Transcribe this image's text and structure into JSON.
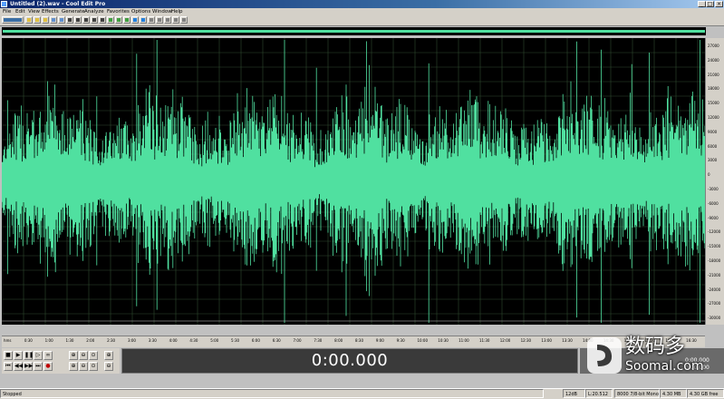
{
  "window": {
    "title": "Untitled (2).wav - Cool Edit Pro",
    "controls": [
      "_",
      "□",
      "×"
    ]
  },
  "menu": [
    "File",
    "Edit",
    "View",
    "Effects",
    "Generate",
    "Analyze",
    "Favorites",
    "Options",
    "Window",
    "Help"
  ],
  "colors": {
    "waveform": "#50e0a0",
    "background": "#000000",
    "grid": "#2e4a2e"
  },
  "icons": {
    "app": "cool-edit-icon",
    "transport": [
      "stop-icon",
      "play-icon",
      "pause-icon",
      "play-loop-icon",
      "loop-icon",
      "go-start-icon",
      "rewind-icon",
      "fast-forward-icon",
      "go-end-icon",
      "record-icon"
    ],
    "zoom": [
      "zoom-in-horizontal-icon",
      "zoom-out-horizontal-icon",
      "zoom-full-icon",
      "zoom-in-vertical-icon",
      "zoom-out-vertical-icon",
      "zoom-selection-icon"
    ]
  },
  "amplitude_ruler": {
    "labels": [
      "27000",
      "24000",
      "21000",
      "18000",
      "15000",
      "12000",
      "9000",
      "6000",
      "3000",
      "0",
      "-3000",
      "-6000",
      "-9000",
      "-12000",
      "-15000",
      "-18000",
      "-21000",
      "-24000",
      "-27000",
      "-30000"
    ]
  },
  "time_ruler": {
    "labels": [
      "hms",
      "0:30",
      "1:00",
      "1:30",
      "2:00",
      "2:30",
      "3:00",
      "3:30",
      "4:00",
      "4:30",
      "5:00",
      "5:30",
      "6:00",
      "6:30",
      "7:00",
      "7:30",
      "8:00",
      "8:30",
      "9:00",
      "9:30",
      "10:00",
      "10:30",
      "11:00",
      "11:30",
      "12:00",
      "12:30",
      "13:00",
      "13:30",
      "14:00",
      "14:30",
      "15:00",
      "15:30",
      "16:00",
      "16:30"
    ]
  },
  "time_display": {
    "value": "0:00.000"
  },
  "info_panel": {
    "value1": "0:00.000",
    "value2": "0:00.000"
  },
  "watermark": {
    "cn": "数码多",
    "en": "Soomal.com"
  },
  "status": {
    "state": "Stopped",
    "zoom": "12dB",
    "duration": "L:20.512",
    "format": "8000 7/8-bit Mono",
    "size": "4.30 MB",
    "free": "4.30 GB free"
  }
}
